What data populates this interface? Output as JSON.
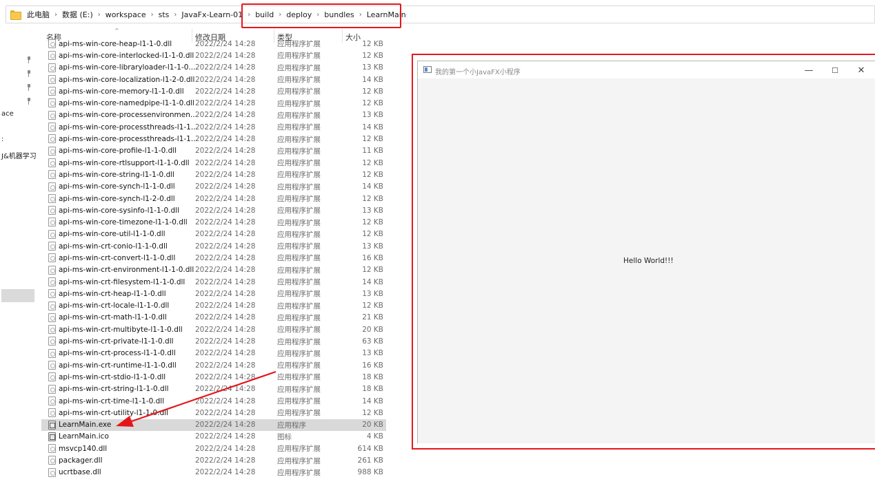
{
  "breadcrumb": [
    "此电脑",
    "数据 (E:)",
    "workspace",
    "sts",
    "JavaFx-Learn-01",
    "build",
    "deploy",
    "bundles",
    "LearnMain"
  ],
  "nav": {
    "labels": [
      "ace",
      ":",
      "J&机器学习"
    ]
  },
  "columns": {
    "name": "名称",
    "date": "修改日期",
    "type": "类型",
    "size": "大小"
  },
  "files": [
    {
      "name": "api-ms-win-core-heap-l1-1-0.dll",
      "date": "2022/2/24 14:28",
      "type": "应用程序扩展",
      "size": "12 KB",
      "icon": "dll"
    },
    {
      "name": "api-ms-win-core-interlocked-l1-1-0.dll",
      "date": "2022/2/24 14:28",
      "type": "应用程序扩展",
      "size": "12 KB",
      "icon": "dll"
    },
    {
      "name": "api-ms-win-core-libraryloader-l1-1-0....",
      "date": "2022/2/24 14:28",
      "type": "应用程序扩展",
      "size": "13 KB",
      "icon": "dll"
    },
    {
      "name": "api-ms-win-core-localization-l1-2-0.dll",
      "date": "2022/2/24 14:28",
      "type": "应用程序扩展",
      "size": "14 KB",
      "icon": "dll"
    },
    {
      "name": "api-ms-win-core-memory-l1-1-0.dll",
      "date": "2022/2/24 14:28",
      "type": "应用程序扩展",
      "size": "12 KB",
      "icon": "dll"
    },
    {
      "name": "api-ms-win-core-namedpipe-l1-1-0.dll",
      "date": "2022/2/24 14:28",
      "type": "应用程序扩展",
      "size": "12 KB",
      "icon": "dll"
    },
    {
      "name": "api-ms-win-core-processenvironmen...",
      "date": "2022/2/24 14:28",
      "type": "应用程序扩展",
      "size": "13 KB",
      "icon": "dll"
    },
    {
      "name": "api-ms-win-core-processthreads-l1-1...",
      "date": "2022/2/24 14:28",
      "type": "应用程序扩展",
      "size": "14 KB",
      "icon": "dll"
    },
    {
      "name": "api-ms-win-core-processthreads-l1-1...",
      "date": "2022/2/24 14:28",
      "type": "应用程序扩展",
      "size": "12 KB",
      "icon": "dll"
    },
    {
      "name": "api-ms-win-core-profile-l1-1-0.dll",
      "date": "2022/2/24 14:28",
      "type": "应用程序扩展",
      "size": "11 KB",
      "icon": "dll"
    },
    {
      "name": "api-ms-win-core-rtlsupport-l1-1-0.dll",
      "date": "2022/2/24 14:28",
      "type": "应用程序扩展",
      "size": "12 KB",
      "icon": "dll"
    },
    {
      "name": "api-ms-win-core-string-l1-1-0.dll",
      "date": "2022/2/24 14:28",
      "type": "应用程序扩展",
      "size": "12 KB",
      "icon": "dll"
    },
    {
      "name": "api-ms-win-core-synch-l1-1-0.dll",
      "date": "2022/2/24 14:28",
      "type": "应用程序扩展",
      "size": "14 KB",
      "icon": "dll"
    },
    {
      "name": "api-ms-win-core-synch-l1-2-0.dll",
      "date": "2022/2/24 14:28",
      "type": "应用程序扩展",
      "size": "12 KB",
      "icon": "dll"
    },
    {
      "name": "api-ms-win-core-sysinfo-l1-1-0.dll",
      "date": "2022/2/24 14:28",
      "type": "应用程序扩展",
      "size": "13 KB",
      "icon": "dll"
    },
    {
      "name": "api-ms-win-core-timezone-l1-1-0.dll",
      "date": "2022/2/24 14:28",
      "type": "应用程序扩展",
      "size": "12 KB",
      "icon": "dll"
    },
    {
      "name": "api-ms-win-core-util-l1-1-0.dll",
      "date": "2022/2/24 14:28",
      "type": "应用程序扩展",
      "size": "12 KB",
      "icon": "dll"
    },
    {
      "name": "api-ms-win-crt-conio-l1-1-0.dll",
      "date": "2022/2/24 14:28",
      "type": "应用程序扩展",
      "size": "13 KB",
      "icon": "dll"
    },
    {
      "name": "api-ms-win-crt-convert-l1-1-0.dll",
      "date": "2022/2/24 14:28",
      "type": "应用程序扩展",
      "size": "16 KB",
      "icon": "dll"
    },
    {
      "name": "api-ms-win-crt-environment-l1-1-0.dll",
      "date": "2022/2/24 14:28",
      "type": "应用程序扩展",
      "size": "12 KB",
      "icon": "dll"
    },
    {
      "name": "api-ms-win-crt-filesystem-l1-1-0.dll",
      "date": "2022/2/24 14:28",
      "type": "应用程序扩展",
      "size": "14 KB",
      "icon": "dll"
    },
    {
      "name": "api-ms-win-crt-heap-l1-1-0.dll",
      "date": "2022/2/24 14:28",
      "type": "应用程序扩展",
      "size": "13 KB",
      "icon": "dll"
    },
    {
      "name": "api-ms-win-crt-locale-l1-1-0.dll",
      "date": "2022/2/24 14:28",
      "type": "应用程序扩展",
      "size": "12 KB",
      "icon": "dll"
    },
    {
      "name": "api-ms-win-crt-math-l1-1-0.dll",
      "date": "2022/2/24 14:28",
      "type": "应用程序扩展",
      "size": "21 KB",
      "icon": "dll"
    },
    {
      "name": "api-ms-win-crt-multibyte-l1-1-0.dll",
      "date": "2022/2/24 14:28",
      "type": "应用程序扩展",
      "size": "20 KB",
      "icon": "dll"
    },
    {
      "name": "api-ms-win-crt-private-l1-1-0.dll",
      "date": "2022/2/24 14:28",
      "type": "应用程序扩展",
      "size": "63 KB",
      "icon": "dll"
    },
    {
      "name": "api-ms-win-crt-process-l1-1-0.dll",
      "date": "2022/2/24 14:28",
      "type": "应用程序扩展",
      "size": "13 KB",
      "icon": "dll"
    },
    {
      "name": "api-ms-win-crt-runtime-l1-1-0.dll",
      "date": "2022/2/24 14:28",
      "type": "应用程序扩展",
      "size": "16 KB",
      "icon": "dll"
    },
    {
      "name": "api-ms-win-crt-stdio-l1-1-0.dll",
      "date": "2022/2/24 14:28",
      "type": "应用程序扩展",
      "size": "18 KB",
      "icon": "dll"
    },
    {
      "name": "api-ms-win-crt-string-l1-1-0.dll",
      "date": "2022/2/24 14:28",
      "type": "应用程序扩展",
      "size": "18 KB",
      "icon": "dll"
    },
    {
      "name": "api-ms-win-crt-time-l1-1-0.dll",
      "date": "2022/2/24 14:28",
      "type": "应用程序扩展",
      "size": "14 KB",
      "icon": "dll"
    },
    {
      "name": "api-ms-win-crt-utility-l1-1-0.dll",
      "date": "2022/2/24 14:28",
      "type": "应用程序扩展",
      "size": "12 KB",
      "icon": "dll"
    },
    {
      "name": "LearnMain.exe",
      "date": "2022/2/24 14:28",
      "type": "应用程序",
      "size": "20 KB",
      "icon": "app",
      "selected": true
    },
    {
      "name": "LearnMain.ico",
      "date": "2022/2/24 14:28",
      "type": "图标",
      "size": "4 KB",
      "icon": "app"
    },
    {
      "name": "msvcp140.dll",
      "date": "2022/2/24 14:28",
      "type": "应用程序扩展",
      "size": "614 KB",
      "icon": "dll"
    },
    {
      "name": "packager.dll",
      "date": "2022/2/24 14:28",
      "type": "应用程序扩展",
      "size": "261 KB",
      "icon": "dll"
    },
    {
      "name": "ucrtbase.dll",
      "date": "2022/2/24 14:28",
      "type": "应用程序扩展",
      "size": "988 KB",
      "icon": "dll"
    }
  ],
  "app_window": {
    "title": "我的第一个小JavaFX小程序",
    "content_text": "Hello World!!!",
    "minimize_glyph": "—",
    "maximize_glyph": "☐",
    "close_glyph": "✕"
  },
  "colors": {
    "highlight": "#e5161b",
    "selected_row": "#d9d9d9"
  }
}
